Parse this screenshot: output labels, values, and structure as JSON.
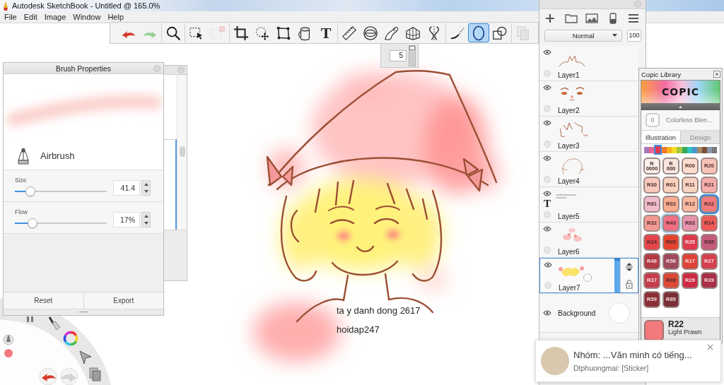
{
  "window": {
    "title": "Autodesk SketchBook - Untitled @ 165.0%"
  },
  "menu": [
    "File",
    "Edit",
    "Image",
    "Window",
    "Help"
  ],
  "toolbar": {
    "groups": [
      {
        "tools": [
          {
            "kind": "undo",
            "selected": false,
            "disabled": false
          },
          {
            "kind": "redo",
            "selected": false,
            "disabled": false
          }
        ]
      },
      {
        "tools": [
          {
            "kind": "zoom",
            "selected": false,
            "disabled": false
          }
        ]
      },
      {
        "tools": [
          {
            "kind": "select",
            "selected": false,
            "disabled": false
          },
          {
            "kind": "transform",
            "selected": false,
            "disabled": true
          }
        ]
      },
      {
        "tools": [
          {
            "kind": "crop",
            "selected": false,
            "disabled": false
          },
          {
            "kind": "move",
            "selected": false,
            "disabled": false
          },
          {
            "kind": "distort",
            "selected": false,
            "disabled": false
          },
          {
            "kind": "fill",
            "selected": false,
            "disabled": false
          },
          {
            "kind": "text",
            "glyph": "T",
            "selected": false,
            "disabled": false
          }
        ]
      },
      {
        "tools": [
          {
            "kind": "ruler",
            "selected": false,
            "disabled": false
          },
          {
            "kind": "ellipse_guide",
            "selected": false,
            "disabled": false
          },
          {
            "kind": "french_curve",
            "selected": false,
            "disabled": false
          },
          {
            "kind": "perspective",
            "selected": false,
            "disabled": false
          },
          {
            "kind": "symmetry",
            "selected": false,
            "disabled": false
          }
        ]
      },
      {
        "tools": [
          {
            "kind": "line",
            "selected": false,
            "disabled": false
          },
          {
            "kind": "ellipse",
            "selected": true,
            "disabled": false
          },
          {
            "kind": "shapes",
            "selected": false,
            "disabled": false
          }
        ]
      },
      {
        "tools": [
          {
            "kind": "copy",
            "selected": false,
            "disabled": true
          }
        ]
      }
    ]
  },
  "size_popup": {
    "value": "5",
    "level": 1
  },
  "canvas": {
    "texts": [
      "ta y danh dong 2617",
      "hoidap247"
    ]
  },
  "brush_properties": {
    "title": "Brush Properties",
    "brush_name": "Airbrush",
    "sliders": [
      {
        "label": "Size",
        "value": "41.4",
        "level": 0.17
      },
      {
        "label": "Flow",
        "value": "17%",
        "level": 0.19
      }
    ],
    "buttons": [
      "Reset",
      "Export"
    ]
  },
  "layers": {
    "blend_mode": "Normal",
    "opacity": "100",
    "items": [
      {
        "name": "Layer1",
        "kind": "paint",
        "visible": true,
        "selected": false
      },
      {
        "name": "Layer2",
        "kind": "paint",
        "visible": true,
        "selected": false
      },
      {
        "name": "Layer3",
        "kind": "paint",
        "visible": true,
        "selected": false
      },
      {
        "name": "Layer4",
        "kind": "paint",
        "visible": true,
        "selected": false
      },
      {
        "name": "Layer5",
        "kind": "text",
        "glyph": "T",
        "visible": true,
        "selected": false
      },
      {
        "name": "Layer6",
        "kind": "paint",
        "visible": true,
        "selected": false
      },
      {
        "name": "Layer7",
        "kind": "paint",
        "visible": true,
        "selected": true
      },
      {
        "name": "Background",
        "kind": "background",
        "visible": true,
        "selected": false
      }
    ]
  },
  "copic_library": {
    "title": "Copic Library",
    "logo": "COPIC",
    "colorless_blender": {
      "code": "0",
      "name": "Colorless Blen...",
      "disabled": true
    },
    "tabs": [
      {
        "label": "Illustration",
        "selected": true
      },
      {
        "label": "Design",
        "selected": false
      }
    ],
    "families": [
      {
        "color": "#a678b8",
        "selected": false
      },
      {
        "color": "#e86890",
        "selected": false
      },
      {
        "color": "#e03a55",
        "selected": true
      },
      {
        "color": "#f07a28",
        "selected": false
      },
      {
        "color": "#f6b21e",
        "selected": false
      },
      {
        "color": "#f2de2a",
        "selected": false
      },
      {
        "color": "#a8c83c",
        "selected": false
      },
      {
        "color": "#34a854",
        "selected": false
      },
      {
        "color": "#2ec4c4",
        "selected": false
      },
      {
        "color": "#4a94d0",
        "selected": false
      },
      {
        "color": "#a88a66",
        "selected": false
      },
      {
        "color": "#7a5038",
        "selected": false
      },
      {
        "color": "#8898a8",
        "selected": false
      },
      {
        "color": "#787878",
        "selected": false
      }
    ],
    "swatches": [
      {
        "code": "R 0000",
        "color": "#faf0ea",
        "selected": false,
        "hovered": false
      },
      {
        "code": "R 000",
        "color": "#f9e6de",
        "selected": false,
        "hovered": false
      },
      {
        "code": "R00",
        "color": "#fbdccf",
        "selected": false,
        "hovered": false
      },
      {
        "code": "R20",
        "color": "#f8c3b8",
        "selected": false,
        "hovered": false
      },
      {
        "code": "R30",
        "color": "#f8c9bd",
        "selected": false,
        "hovered": false
      },
      {
        "code": "R01",
        "color": "#fad1bf",
        "selected": false,
        "hovered": false
      },
      {
        "code": "R11",
        "color": "#f9d3c2",
        "selected": false,
        "hovered": false
      },
      {
        "code": "R21",
        "color": "#f4adaa",
        "selected": false,
        "hovered": false
      },
      {
        "code": "R81",
        "color": "#f0bccd",
        "selected": false,
        "hovered": false
      },
      {
        "code": "R02",
        "color": "#f7ac8e",
        "selected": false,
        "hovered": false
      },
      {
        "code": "R12",
        "color": "#f8b9a0",
        "selected": false,
        "hovered": false
      },
      {
        "code": "R22",
        "color": "#f37a7c",
        "selected": true,
        "hovered": false
      },
      {
        "code": "R32",
        "color": "#f39a92",
        "selected": false,
        "hovered": false
      },
      {
        "code": "R43",
        "color": "#f06f84",
        "selected": false,
        "hovered": true
      },
      {
        "code": "R83",
        "color": "#e592ad",
        "selected": false,
        "hovered": false
      },
      {
        "code": "R14",
        "color": "#ef5a57",
        "selected": false,
        "hovered": false
      },
      {
        "code": "R24",
        "color": "#e5454a",
        "selected": false,
        "hovered": false
      },
      {
        "code": "R05",
        "color": "#e6432f",
        "selected": false,
        "hovered": false
      },
      {
        "code": "R35",
        "color": "#de3a4c",
        "selected": false,
        "hovered": false
      },
      {
        "code": "R85",
        "color": "#c55a7c",
        "selected": false,
        "hovered": false
      },
      {
        "code": "R46",
        "color": "#b33a44",
        "selected": false,
        "hovered": false
      },
      {
        "code": "R56",
        "color": "#9e4a5c",
        "selected": false,
        "hovered": false
      },
      {
        "code": "R17",
        "color": "#df4236",
        "selected": false,
        "hovered": false
      },
      {
        "code": "R27",
        "color": "#d6404f",
        "selected": false,
        "hovered": false
      },
      {
        "code": "R37",
        "color": "#c63e4e",
        "selected": false,
        "hovered": false
      },
      {
        "code": "R08",
        "color": "#dc4a36",
        "selected": false,
        "hovered": false
      },
      {
        "code": "R29",
        "color": "#cd2b43",
        "selected": false,
        "hovered": false
      },
      {
        "code": "R39",
        "color": "#a92f46",
        "selected": false,
        "hovered": false
      },
      {
        "code": "R59",
        "color": "#8c3038",
        "selected": false,
        "hovered": false
      },
      {
        "code": "R89",
        "color": "#7a3036",
        "selected": false,
        "hovered": false
      }
    ],
    "current": {
      "code": "R22",
      "name": "Light Prawn"
    }
  },
  "notification": {
    "title": "Nhóm: ...Văn minh có tiếng...",
    "message": "Dtphuongmai: [Sticker]"
  }
}
